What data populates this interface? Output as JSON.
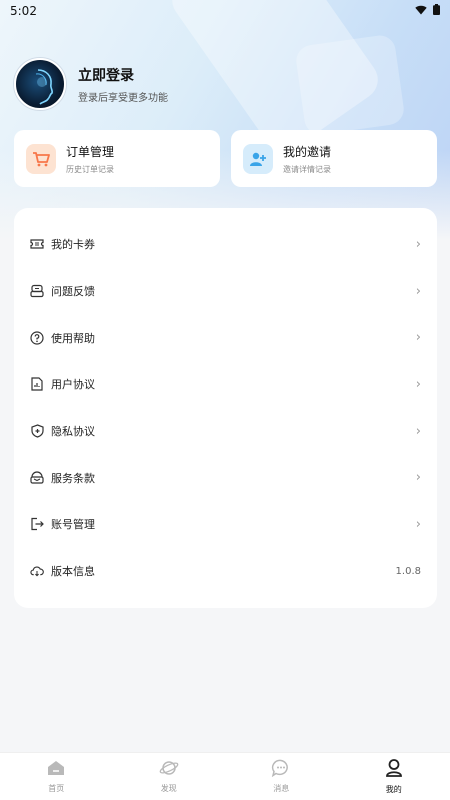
{
  "status_bar": {
    "time": "5:02"
  },
  "profile": {
    "title": "立即登录",
    "subtitle": "登录后享受更多功能"
  },
  "quick_cards": [
    {
      "title": "订单管理",
      "subtitle": "历史订单记录",
      "icon": "cart-icon",
      "color": "#f7774a"
    },
    {
      "title": "我的邀请",
      "subtitle": "邀请详情记录",
      "icon": "add-user-icon",
      "color": "#3aa4e8"
    }
  ],
  "menu": [
    {
      "label": "我的卡券",
      "icon": "ticket-icon"
    },
    {
      "label": "问题反馈",
      "icon": "feedback-icon"
    },
    {
      "label": "使用帮助",
      "icon": "help-icon"
    },
    {
      "label": "用户协议",
      "icon": "document-icon"
    },
    {
      "label": "隐私协议",
      "icon": "shield-icon"
    },
    {
      "label": "服务条款",
      "icon": "service-icon"
    },
    {
      "label": "账号管理",
      "icon": "logout-icon"
    },
    {
      "label": "版本信息",
      "icon": "cloud-icon",
      "value": "1.0.8"
    }
  ],
  "chevron": "›",
  "tabbar": {
    "items": [
      {
        "label": "首页",
        "icon": "home-icon"
      },
      {
        "label": "发现",
        "icon": "planet-icon"
      },
      {
        "label": "消息",
        "icon": "chat-icon"
      },
      {
        "label": "我的",
        "icon": "user-icon",
        "active": true
      }
    ]
  }
}
